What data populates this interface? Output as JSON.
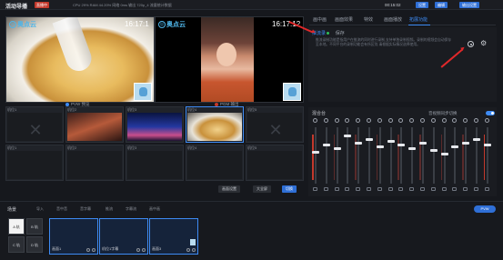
{
  "topbar": {
    "title": "活动导播",
    "live_badge": "直播中",
    "stats": "CPU 29%  RAM 44.20%  网络 0ms  输出 720p_4  流量统计数据",
    "clock": "00:15:02",
    "btn_a": "设置",
    "btn_b": "编辑",
    "btn_c": "输出设置"
  },
  "monitor": {
    "preview_logo": "奥点云",
    "preview_time": "16:17:1",
    "program_logo": "奥点云",
    "program_time": "16:17:12",
    "pvw_label": "PVW 预览",
    "pgm_label": "PGM 输出"
  },
  "tabs": [
    "画中画",
    "画面效果",
    "特效",
    "画面播放",
    "拓展功能"
  ],
  "panel": {
    "sub_active": "推流录",
    "sub_other": "保存",
    "description": "推流录制功能是指用户在推流的同时进行录制,支持单独录制视频。录制的视频会自动保存至本地。不同平台的录制功能会有所区别,请根据实际情况选择使用。"
  },
  "grid": {
    "labels": [
      "机位1",
      "机位2",
      "机位3",
      "机位4",
      "机位5",
      "机位1",
      "机位2",
      "机位3",
      "机位4",
      "机位5"
    ],
    "btn_1": "画面设置",
    "btn_2": "大全屏",
    "btn_3": "切换"
  },
  "mixer": {
    "title": "混合台",
    "sync_label": "音视频同步切换"
  },
  "bottom": {
    "title": "场景",
    "tools": [
      "导入",
      "音中音",
      "音字幕",
      "推流",
      "字幕流",
      "画中画"
    ],
    "pvw_button": "PVW",
    "a_label": "A 轨",
    "b_label": "B 轨",
    "c_label": "C 轨",
    "d_label": "D 轨",
    "scenes": [
      "画面1",
      "机位1字幕",
      "画面3"
    ]
  },
  "colors": {
    "accent": "#3e8bf4",
    "live_red": "#c3392c",
    "annotation_red": "#e0282a"
  }
}
